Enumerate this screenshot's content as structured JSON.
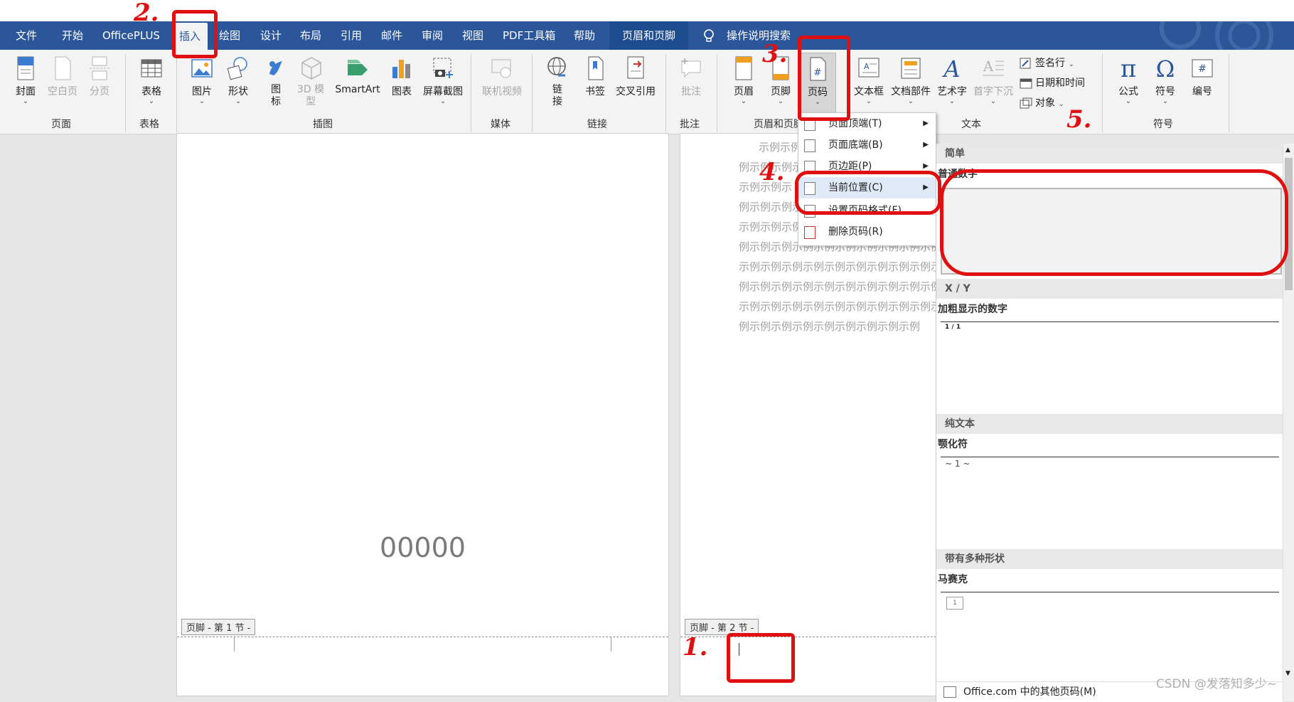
{
  "tabs": [
    "文件",
    "开始",
    "OfficePLUS",
    "插入",
    "绘图",
    "设计",
    "布局",
    "引用",
    "邮件",
    "审阅",
    "视图",
    "PDF工具箱",
    "帮助"
  ],
  "context_tab": "页眉和页脚",
  "tell_me": "操作说明搜索",
  "ribbon": {
    "pages_group": {
      "label": "页面",
      "cover": "封面",
      "blank": "空白页",
      "break": "分页"
    },
    "table_group": {
      "label": "表格",
      "table": "表格"
    },
    "illus_group": {
      "label": "插图",
      "picture": "图片",
      "shapes": "形状",
      "icons": "图标",
      "model3d": "3D 模型",
      "smartart": "SmartArt",
      "chart": "图表",
      "screenshot": "屏幕截图"
    },
    "media_group": {
      "label": "媒体",
      "online_video": "联机视频"
    },
    "links_group": {
      "label": "链接",
      "link": "链接",
      "bookmark": "书签",
      "xref": "交叉引用"
    },
    "comments_group": {
      "label": "批注",
      "comment": "批注"
    },
    "hf_group": {
      "label": "页眉和页脚",
      "header": "页眉",
      "footer": "页脚",
      "page_number": "页码"
    },
    "text_group": {
      "label": "文本",
      "textbox": "文本框",
      "quickparts": "文档部件",
      "wordart": "艺术字",
      "dropcap": "首字下沉",
      "signature": "签名行",
      "datetime": "日期和时间",
      "object": "对象"
    },
    "symbols_group": {
      "label": "符号",
      "equation": "公式",
      "symbol": "符号",
      "number": "编号"
    }
  },
  "menu": [
    {
      "label": "页面顶端(T)",
      "submenu": true
    },
    {
      "label": "页面底端(B)",
      "submenu": true
    },
    {
      "label": "页边距(P)",
      "submenu": true
    },
    {
      "label": "当前位置(C)",
      "submenu": true
    },
    {
      "label": "设置页码格式(F)...",
      "submenu": false
    },
    {
      "label": "删除页码(R)",
      "submenu": false
    }
  ],
  "gallery": {
    "sections": [
      {
        "header": "简单",
        "item": "普通数字",
        "preview": ""
      },
      {
        "header": "X / Y",
        "item": "加粗显示的数字",
        "preview": "1 / 1"
      },
      {
        "header": "纯文本",
        "item": "颚化符",
        "preview": "~ 1 ~"
      },
      {
        "header": "带有多种形状",
        "item": "马赛克",
        "preview": "1"
      }
    ],
    "more": "Office.com 中的其他页码(M)"
  },
  "doc": {
    "page1_number": "00000",
    "footer1": "页脚 - 第 1 节 -",
    "footer2": "页脚 - 第 2 节 -",
    "sample_lines": [
      "示例示例",
      "例示例示例示",
      "示例示例示",
      "例示例示例示",
      "示例示例示例",
      "例示例示例示例示例示例示例示例示例示例",
      "示例示例示例示例示例示例示例示例示例示例",
      "例示例示例示例示例示例示例示例示例示例示例",
      "示例示例示例示例示例示例示例示例示例示例示例",
      "例示例示例示例示例示例示例示例示例"
    ],
    "partial_line": "例示例示例示例示例示例示例示例"
  },
  "annotations": [
    "1.",
    "2.",
    "3.",
    "4.",
    "5."
  ],
  "watermark": "CSDN @发落知多少~"
}
